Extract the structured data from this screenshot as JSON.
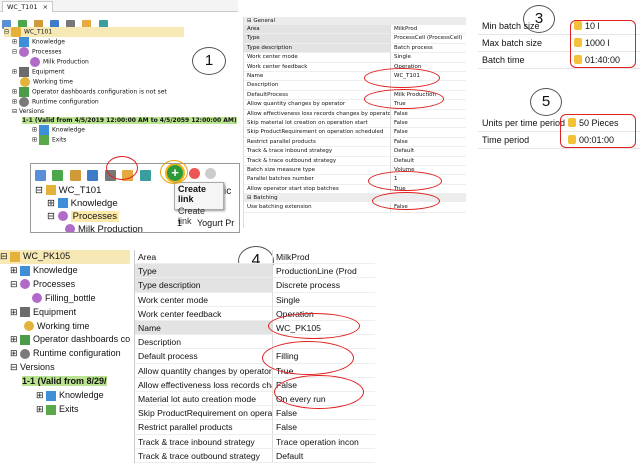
{
  "tab": {
    "label": "WC_T101",
    "close": "×"
  },
  "tree1": {
    "root": "WC_T101",
    "knowledge": "Knowledge",
    "processes": "Processes",
    "milk": "Milk Production",
    "equipment": "Equipment",
    "working_time": "Working time",
    "dashboards": "Operator dashboards configuration is not set",
    "runtime": "Runtime configuration",
    "versions": "Versions",
    "version": "1-1 (Valid from 4/5/2019 12:00:00 AM to 4/5/2059 12:00:00 AM)",
    "v_knowledge": "Knowledge",
    "v_exits": "Exits"
  },
  "callouts": {
    "c1": "1",
    "c3": "3",
    "c4": "4",
    "c5": "5"
  },
  "props1": {
    "section": "General",
    "rows": [
      {
        "k": "Area",
        "v": "MilkProd"
      },
      {
        "k": "Type",
        "v": "ProcessCell (ProcessCell)"
      },
      {
        "k": "Type description",
        "v": "Batch process"
      },
      {
        "k": "Work center mode",
        "v": "Single"
      },
      {
        "k": "Work center feedback",
        "v": "Operation"
      },
      {
        "k": "Name",
        "v": "WC_T101"
      },
      {
        "k": "Description",
        "v": ""
      },
      {
        "k": "DefaultProcess",
        "v": "Milk Production"
      },
      {
        "k": "Allow quantity changes by operator",
        "v": "True"
      },
      {
        "k": "Allow effectiveness loss records changes by operator",
        "v": "False"
      },
      {
        "k": "Skip material lot creation on operation start",
        "v": "False"
      },
      {
        "k": "Skip ProductRequirement on operation scheduled",
        "v": "False"
      },
      {
        "k": "Restrict parallel products",
        "v": "False"
      },
      {
        "k": "Track & trace inbound strategy",
        "v": "Default"
      },
      {
        "k": "Track & trace outbound strategy",
        "v": "Default"
      },
      {
        "k": "Batch size measure type",
        "v": "Volume"
      },
      {
        "k": "Parallel batches number",
        "v": "1"
      },
      {
        "k": "Allow operator start stop batches",
        "v": "True"
      }
    ],
    "section2": "Batching",
    "rows2": [
      {
        "k": "Use batching extension",
        "v": "False"
      }
    ]
  },
  "batch": {
    "rows": [
      {
        "k": "Min batch size",
        "v": "10 l"
      },
      {
        "k": "Max batch size",
        "v": "1000 l"
      },
      {
        "k": "Batch time",
        "v": "01:40:00"
      }
    ]
  },
  "units": {
    "rows": [
      {
        "k": "Units per time period",
        "v": "50 Pieces"
      },
      {
        "k": "Time period",
        "v": "00:01:00"
      }
    ]
  },
  "zoom": {
    "root": "WC_T101",
    "knowledge": "Knowledge",
    "processes": "Processes",
    "milk": "Milk Production",
    "menu_title": "Create link",
    "menu_item": "Create link",
    "grid_num": "1",
    "grid_val": "Yogurt Pr",
    "col_head": "ic"
  },
  "tree2": {
    "root": "WC_PK105",
    "knowledge": "Knowledge",
    "processes": "Processes",
    "filling": "Filling_bottle",
    "equipment": "Equipment",
    "working_time": "Working time",
    "dashboards": "Operator dashboards co",
    "runtime": "Runtime configuration",
    "versions": "Versions",
    "version": "1-1 (Valid from 8/29/",
    "v_knowledge": "Knowledge",
    "v_exits": "Exits"
  },
  "props2": {
    "rows": [
      {
        "k": "Area",
        "v": "MilkProd"
      },
      {
        "k": "Type",
        "v": "ProductionLine (Prod"
      },
      {
        "k": "Type description",
        "v": "Discrete process"
      },
      {
        "k": "Work center mode",
        "v": "Single"
      },
      {
        "k": "Work center feedback",
        "v": "Operation"
      },
      {
        "k": "Name",
        "v": "WC_PK105"
      },
      {
        "k": "Description",
        "v": ""
      },
      {
        "k": "Default process",
        "v": "Filling"
      },
      {
        "k": "Allow quantity changes by operator",
        "v": "True"
      },
      {
        "k": "Allow effectiveness loss records changes",
        "v": "False"
      },
      {
        "k": "Material lot auto creation mode",
        "v": "On every run"
      },
      {
        "k": "Skip ProductRequirement on operation s",
        "v": "False"
      },
      {
        "k": "Restrict parallel products",
        "v": "False"
      },
      {
        "k": "Track & trace inbound strategy",
        "v": "Trace operation incon"
      },
      {
        "k": "Track & trace outbound strategy",
        "v": "Default"
      }
    ]
  },
  "colors": {
    "accent": "#e02020",
    "highlight": "#fde9a8",
    "version_green": "#b9e38f",
    "select_gray": "#e3e3e3"
  }
}
